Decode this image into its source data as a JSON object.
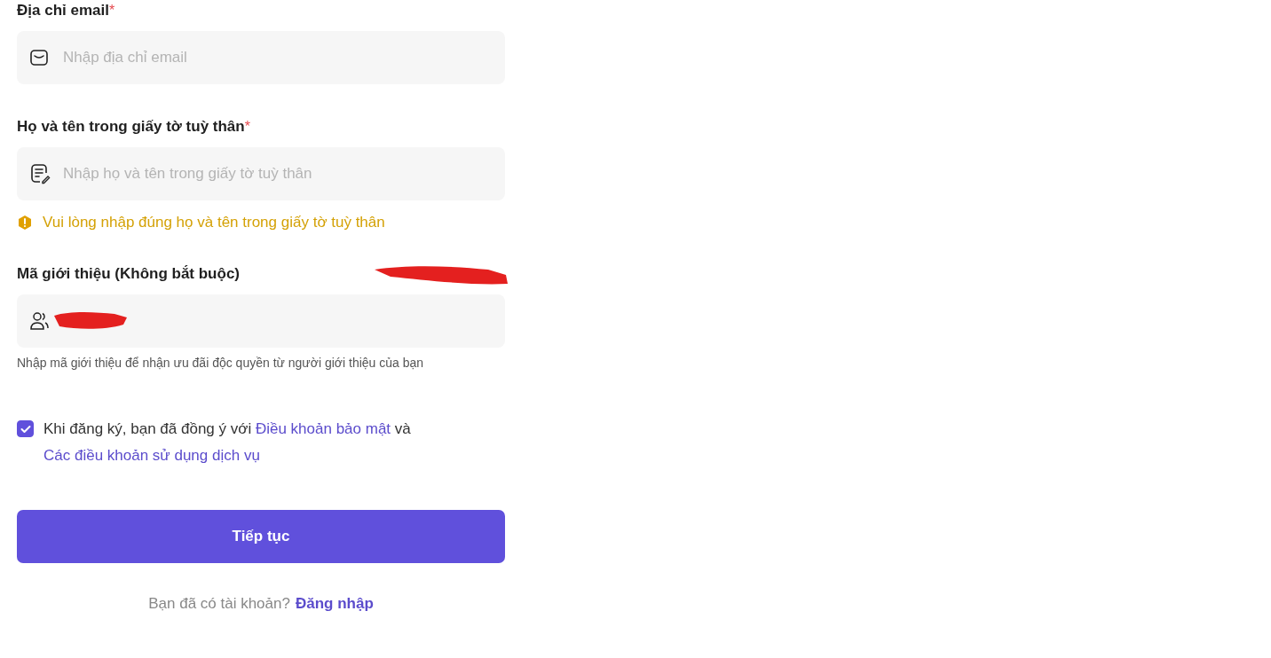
{
  "fields": [
    {
      "kind": "email",
      "label": "Địa chỉ email",
      "required_mark": "*",
      "placeholder": "Nhập địa chỉ email"
    },
    {
      "kind": "id-name",
      "label": "Họ và tên trong giấy tờ tuỳ thân",
      "required_mark": "*",
      "placeholder": "Nhập họ và tên trong giấy tờ tuỳ thân",
      "warning": "Vui lòng nhập đúng họ và tên trong giấy tờ tuỳ thân"
    },
    {
      "kind": "referral",
      "label": "Mã giới thiệu (Không bắt buộc)",
      "redacted": true,
      "helper": "Nhập mã giới thiệu để nhận ưu đãi độc quyền từ người giới thiệu của bạn"
    }
  ],
  "consent": {
    "checked": true,
    "before": "Khi đăng ký, bạn đã đồng ý với ",
    "link1": "Điều khoản bảo mật",
    "middle": " và ",
    "link2": "Các điều khoản sử dụng dịch vụ"
  },
  "submit": "Tiếp tục",
  "footer": {
    "prompt": "Bạn đã có tài khoản?",
    "link": "Đăng nhập"
  }
}
